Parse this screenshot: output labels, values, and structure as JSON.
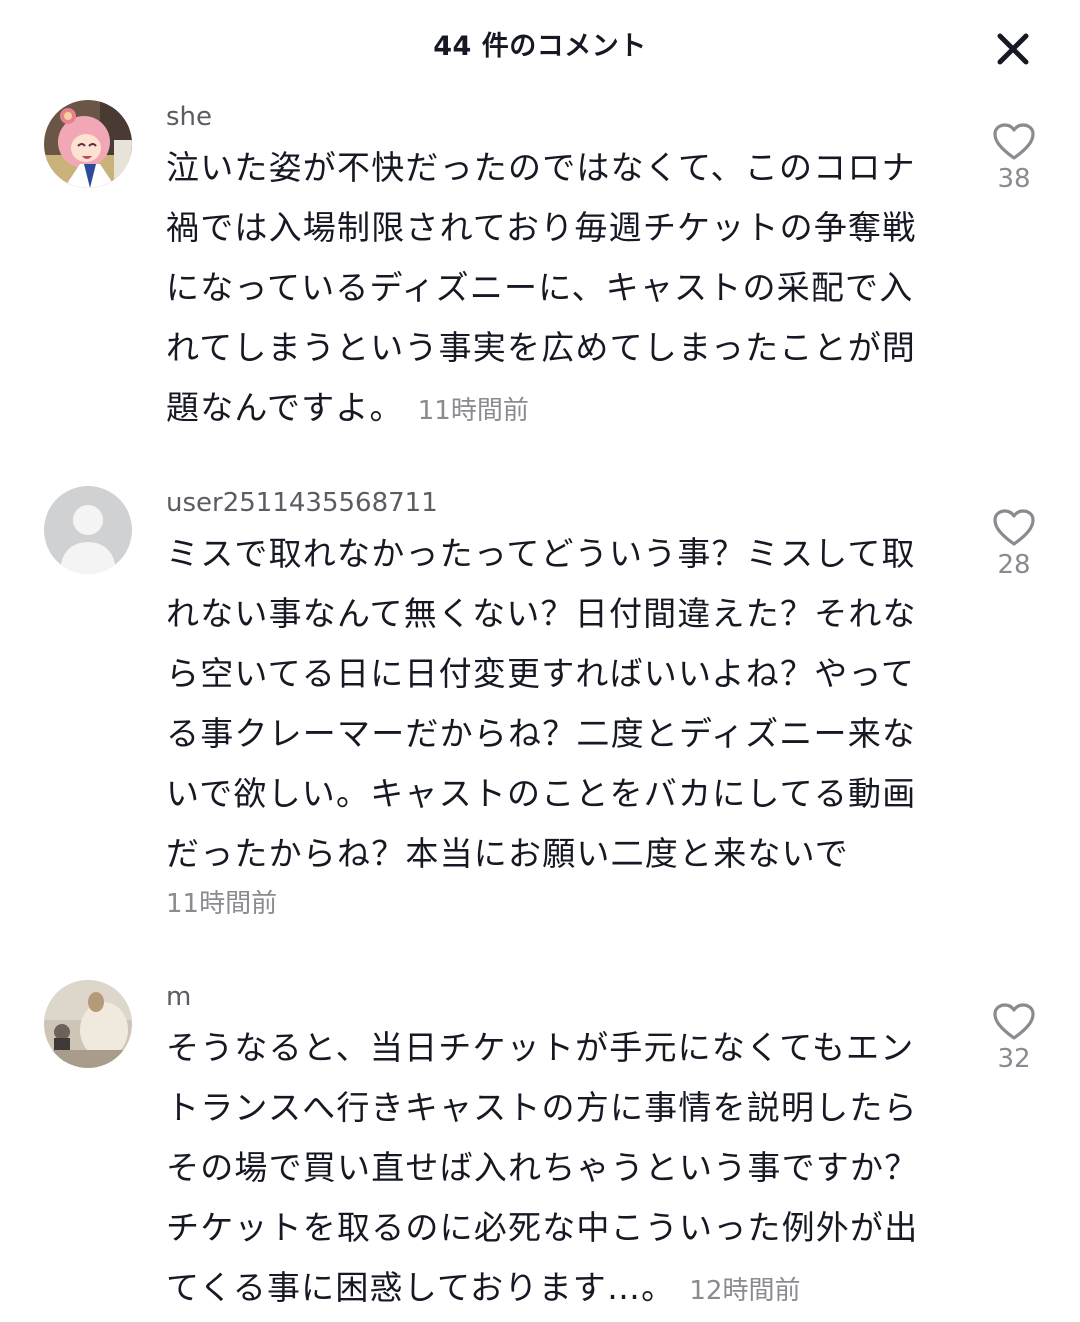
{
  "header": {
    "title": "44 件のコメント"
  },
  "comments": [
    {
      "username": "she",
      "text": "泣いた姿が不快だったのではなくて、このコロナ禍では入場制限されており毎週チケットの争奪戦になっているディズニーに、キャストの采配で入れてしまうという事実を広めてしまったことが問題なんですよ。",
      "time": "11時間前",
      "likes": "38",
      "avatar_icon": "anime-girl-avatar"
    },
    {
      "username": "user2511435568711",
      "text": "ミスで取れなかったってどういう事？ミスして取れない事なんて無くない？日付間違えた？それなら空いてる日に日付変更すればいいよね？やってる事クレーマーだからね？二度とディズニー来ないで欲しい。キャストのことをバカにしてる動画だったからね？本当にお願い二度と来ないで",
      "time": "11時間前",
      "likes": "28",
      "avatar_icon": "default-user-avatar"
    },
    {
      "username": "m",
      "text": "そうなると、当日チケットが手元になくてもエントランスへ行きキャストの方に事情を説明したらその場で買い直せば入れちゃうという事ですか？チケットを取るのに必死な中こういった例外が出てくる事に困惑しております…。",
      "time": "12時間前",
      "likes": "32",
      "avatar_icon": "photo-avatar"
    }
  ],
  "colors": {
    "text": "#161823",
    "secondary": "#8a8b91",
    "username": "#5b5b62"
  }
}
